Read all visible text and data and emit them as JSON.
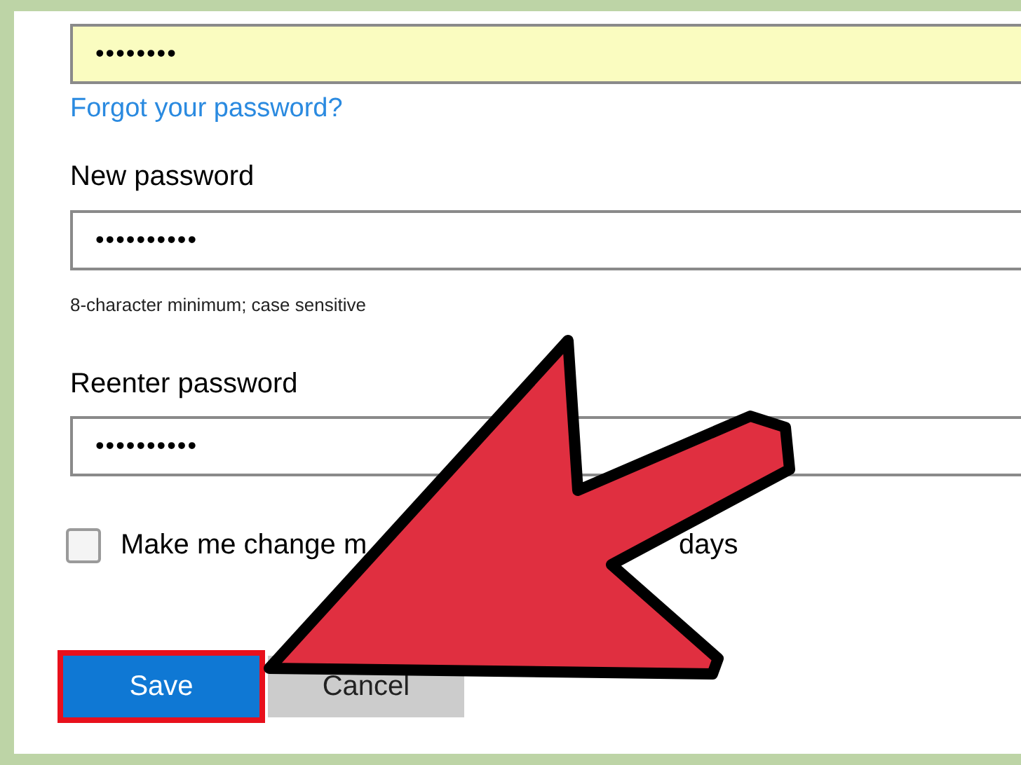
{
  "current_password": {
    "value": "••••••••",
    "autofilled": true
  },
  "forgot_link": "Forgot your password?",
  "new_password": {
    "label": "New password",
    "value": "••••••••••",
    "hint": "8-character minimum; case sensitive"
  },
  "reenter_password": {
    "label": "Reenter password",
    "value": "••••••••••"
  },
  "expiry_checkbox": {
    "label_parts": [
      "Make me change m",
      "days"
    ],
    "checked": false
  },
  "buttons": [
    {
      "label": "Save",
      "kind": "primary",
      "highlighted": true
    },
    {
      "label": "Cancel",
      "kind": "secondary",
      "highlighted": false
    }
  ]
}
